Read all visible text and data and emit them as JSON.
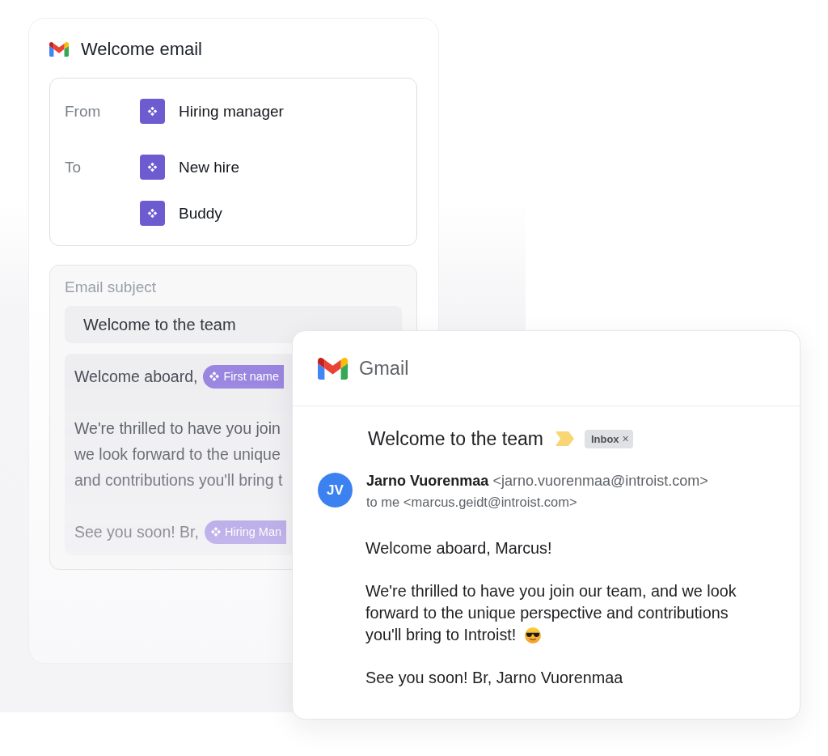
{
  "editor": {
    "title": "Welcome email",
    "participants": [
      {
        "role": "From",
        "name": "Hiring manager"
      },
      {
        "role": "To",
        "name": "New hire"
      },
      {
        "name": "Buddy"
      }
    ],
    "subject_label": "Email subject",
    "subject_value": "Welcome to the team",
    "body": [
      {
        "lines": [
          {
            "text": "Welcome aboard,",
            "variable": "First name"
          }
        ]
      },
      {
        "lines": [
          {
            "text": "We're thrilled to have you join"
          },
          {
            "text": "we look forward to the unique"
          },
          {
            "text": "and contributions you'll bring t"
          }
        ]
      },
      {
        "lines": [
          {
            "text": "See you soon! Br,",
            "variable": "Hiring Man"
          }
        ]
      }
    ]
  },
  "gmail": {
    "app_name": "Gmail",
    "subject": "Welcome to the team",
    "label": {
      "text": "Inbox",
      "remove": "×"
    },
    "sender": {
      "initials": "JV",
      "name": "Jarno Vuorenmaa",
      "email": "<jarno.vuorenmaa@introist.com>",
      "recipient": "to me <marcus.geidt@introist.com>"
    },
    "message": [
      {
        "kind": "text",
        "text": "Welcome aboard, Marcus!"
      },
      {
        "kind": "text_emoji",
        "text": "We're thrilled to have you join our team, and we look forward to the unique perspective and contributions",
        "text_end": "you'll bring to Introist!"
      },
      {
        "kind": "text",
        "text": "See you soon! Br, Jarno Vuorenmaa"
      }
    ]
  }
}
